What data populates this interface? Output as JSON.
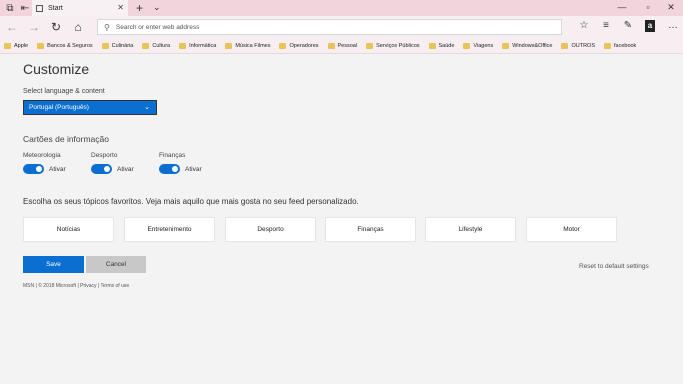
{
  "browser": {
    "tab_title": "Start",
    "address_placeholder": "Search or enter web address",
    "favorites": [
      "Apple",
      "Bancos & Seguros",
      "Culinária",
      "Cultura",
      "Informática",
      "Música Filmes",
      "Operadores",
      "Pessoal",
      "Serviços Públicos",
      "Saúde",
      "Viagens",
      "Windows&Office",
      "OUTROS",
      "facebook"
    ]
  },
  "page": {
    "title": "Customize",
    "language_label": "Select language & content",
    "language_value": "Portugal (Português)",
    "cards_title": "Cartões de informação",
    "cards": [
      {
        "label": "Meteorologia",
        "state": "Ativar"
      },
      {
        "label": "Desporto",
        "state": "Ativar"
      },
      {
        "label": "Finanças",
        "state": "Ativar"
      }
    ],
    "topics_title": "Escolha os seus tópicos favoritos. Veja mais aquilo que mais gosta no seu feed personalizado.",
    "topics": [
      "Notícias",
      "Entretenimento",
      "Desporto",
      "Finanças",
      "Lifestyle",
      "Motor"
    ],
    "save_label": "Save",
    "cancel_label": "Cancel",
    "reset_label": "Reset to default settings",
    "footer": "MSN | © 2018 Microsoft | Privacy | Terms of use"
  },
  "colors": {
    "accent": "#0a6fd1",
    "titlebar": "#f2d4dc"
  },
  "icons": [
    "tab-list-icon",
    "back-icon",
    "forward-icon",
    "refresh-icon",
    "home-icon",
    "search-icon",
    "favorites-icon",
    "reading-list-icon",
    "pen-icon",
    "share-icon",
    "amazon-icon",
    "more-icon"
  ]
}
